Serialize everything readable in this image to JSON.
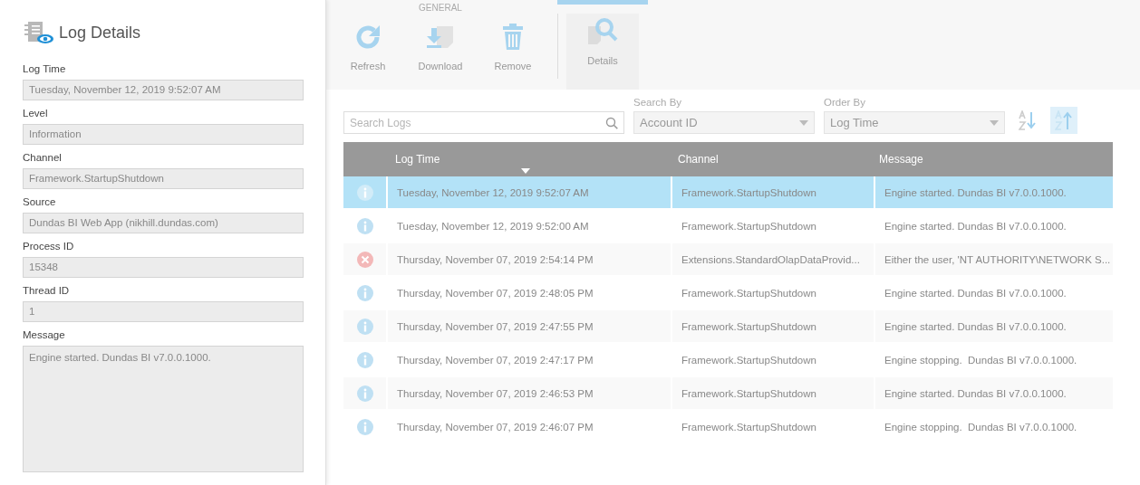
{
  "details_panel": {
    "title": "Log Details",
    "fields": [
      {
        "label": "Log Time",
        "value": "Tuesday, November 12, 2019 9:52:07 AM",
        "kind": "line"
      },
      {
        "label": "Level",
        "value": "Information",
        "kind": "line"
      },
      {
        "label": "Channel",
        "value": "Framework.StartupShutdown",
        "kind": "line"
      },
      {
        "label": "Source",
        "value": "Dundas BI Web App (nikhill.dundas.com)",
        "kind": "line"
      },
      {
        "label": "Process ID",
        "value": "15348",
        "kind": "line"
      },
      {
        "label": "Thread ID",
        "value": "1",
        "kind": "line"
      },
      {
        "label": "Message",
        "value": "Engine started. Dundas BI v7.0.0.1000.",
        "kind": "area"
      }
    ]
  },
  "toolbar": {
    "group_label": "GENERAL",
    "buttons": [
      {
        "label": "Refresh",
        "kind": "refresh",
        "selected": false
      },
      {
        "label": "Download",
        "kind": "download",
        "selected": false
      },
      {
        "label": "Remove",
        "kind": "remove",
        "selected": false
      }
    ],
    "extra_buttons": [
      {
        "label": "Details",
        "kind": "details",
        "selected": true
      }
    ]
  },
  "filters": {
    "search": {
      "placeholder": "Search Logs"
    },
    "search_by": {
      "label": "Search By",
      "value": "Account ID"
    },
    "order_by": {
      "label": "Order By",
      "value": "Log Time"
    },
    "sort_buttons": [
      {
        "kind": "ascending",
        "selected": false
      },
      {
        "kind": "descending",
        "selected": true
      }
    ]
  },
  "table": {
    "columns": [
      "Log Time",
      "Channel",
      "Message"
    ],
    "rows": [
      {
        "kind": "info",
        "time": "Tuesday, November 12, 2019 9:52:07 AM",
        "channel": "Framework.StartupShutdown",
        "message": "Engine started. Dundas BI v7.0.0.1000.",
        "selected": true
      },
      {
        "kind": "info",
        "time": "Tuesday, November 12, 2019 9:52:00 AM",
        "channel": "Framework.StartupShutdown",
        "message": "Engine started. Dundas BI v7.0.0.1000.",
        "selected": false
      },
      {
        "kind": "error",
        "time": "Thursday, November 07, 2019 2:54:14 PM",
        "channel": "Extensions.StandardOlapDataProvid...",
        "message": "Either the user, 'NT AUTHORITY\\NETWORK S...",
        "selected": false
      },
      {
        "kind": "info",
        "time": "Thursday, November 07, 2019 2:48:05 PM",
        "channel": "Framework.StartupShutdown",
        "message": "Engine started. Dundas BI v7.0.0.1000.",
        "selected": false
      },
      {
        "kind": "info",
        "time": "Thursday, November 07, 2019 2:47:55 PM",
        "channel": "Framework.StartupShutdown",
        "message": "Engine started. Dundas BI v7.0.0.1000.",
        "selected": false
      },
      {
        "kind": "info",
        "time": "Thursday, November 07, 2019 2:47:17 PM",
        "channel": "Framework.StartupShutdown",
        "message": "Engine stopping.  Dundas BI v7.0.0.1000.",
        "selected": false
      },
      {
        "kind": "info",
        "time": "Thursday, November 07, 2019 2:46:53 PM",
        "channel": "Framework.StartupShutdown",
        "message": "Engine started. Dundas BI v7.0.0.1000.",
        "selected": false
      },
      {
        "kind": "info",
        "time": "Thursday, November 07, 2019 2:46:07 PM",
        "channel": "Framework.StartupShutdown",
        "message": "Engine stopping.  Dundas BI v7.0.0.1000.",
        "selected": false
      }
    ]
  }
}
